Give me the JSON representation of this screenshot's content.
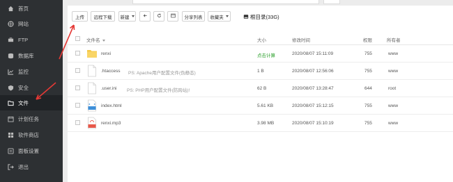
{
  "sidebar": {
    "items": [
      {
        "label": "首页",
        "icon": "home-icon",
        "active": false
      },
      {
        "label": "网站",
        "icon": "globe-icon",
        "active": false
      },
      {
        "label": "FTP",
        "icon": "ftp-icon",
        "active": false
      },
      {
        "label": "数据库",
        "icon": "database-icon",
        "active": false
      },
      {
        "label": "监控",
        "icon": "monitor-icon",
        "active": false
      },
      {
        "label": "安全",
        "icon": "shield-icon",
        "active": false
      },
      {
        "label": "文件",
        "icon": "folder-icon",
        "active": true
      },
      {
        "label": "计划任务",
        "icon": "clock-icon",
        "active": false
      },
      {
        "label": "软件商店",
        "icon": "grid-icon",
        "active": false
      },
      {
        "label": "面板设置",
        "icon": "settings-icon",
        "active": false
      },
      {
        "label": "退出",
        "icon": "logout-icon",
        "active": false
      }
    ]
  },
  "toolbar": {
    "upload": "上传",
    "remote_download": "远程下载",
    "new": "新建",
    "share_list": "分享列表",
    "favorites": "收藏夹",
    "root_dir": "根目录(33G)"
  },
  "table": {
    "headers": {
      "name": "文件名",
      "size": "大小",
      "modified": "修改时间",
      "perm": "权限",
      "owner": "所有者"
    },
    "rows": [
      {
        "name": "renxi",
        "type": "folder",
        "ps": "",
        "size": "点击计算",
        "modified": "2020/08/07 15:11:09",
        "perm": "755",
        "owner": "www"
      },
      {
        "name": ".htaccess",
        "type": "file",
        "ps": "PS: Apache用户配置文件(伪静态)",
        "size": "1 B",
        "modified": "2020/08/07 12:56:06",
        "perm": "755",
        "owner": "www"
      },
      {
        "name": ".user.ini",
        "type": "file",
        "ps": "PS: PHP用户配置文件(防跨站)!",
        "size": "62 B",
        "modified": "2020/08/07 13:28:47",
        "perm": "644",
        "owner": "root"
      },
      {
        "name": "index.html",
        "type": "html",
        "ps": "",
        "size": "5.61 KB",
        "modified": "2020/08/07 15:12:15",
        "perm": "755",
        "owner": "www"
      },
      {
        "name": "renxi.mp3",
        "type": "mp3",
        "ps": "",
        "size": "3.98 MB",
        "modified": "2020/08/07 15:10:19",
        "perm": "755",
        "owner": "www"
      }
    ]
  },
  "colors": {
    "sidebar_bg": "#2d3033",
    "active_bg": "#202326",
    "calc_green": "#2ca02c",
    "arrow_red": "#e53935"
  }
}
